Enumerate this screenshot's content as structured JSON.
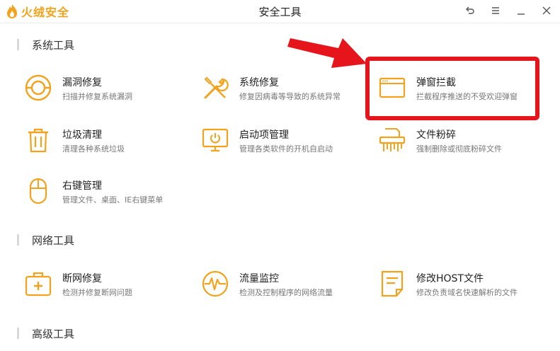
{
  "app": {
    "brand_name": "火绒安全",
    "window_title": "安全工具"
  },
  "sections": [
    {
      "title": "系统工具",
      "tools": [
        {
          "name": "漏洞修复",
          "desc": "扫描并修复系统漏洞",
          "icon": "vulnerability-repair-icon"
        },
        {
          "name": "系统修复",
          "desc": "修复因病毒等导致的系统异常",
          "icon": "system-repair-icon"
        },
        {
          "name": "弹窗拦截",
          "desc": "拦截程序推送的不受欢迎弹窗",
          "icon": "popup-block-icon"
        },
        {
          "name": "垃圾清理",
          "desc": "清理各种系统垃圾",
          "icon": "trash-clean-icon"
        },
        {
          "name": "启动项管理",
          "desc": "管理各类软件的开机自启动",
          "icon": "startup-manager-icon"
        },
        {
          "name": "文件粉碎",
          "desc": "强制删除或彻底粉碎文件",
          "icon": "file-shredder-icon"
        },
        {
          "name": "右键管理",
          "desc": "管理文件、桌面、IE右键菜单",
          "icon": "mouse-menu-icon"
        }
      ]
    },
    {
      "title": "网络工具",
      "tools": [
        {
          "name": "断网修复",
          "desc": "检测并修复断网问题",
          "icon": "network-repair-icon"
        },
        {
          "name": "流量监控",
          "desc": "检测及控制程序的网络流量",
          "icon": "traffic-monitor-icon"
        },
        {
          "name": "修改HOST文件",
          "desc": "修改负责域名快速解析的文件",
          "icon": "host-file-icon"
        }
      ]
    },
    {
      "title": "高级工具",
      "tools": []
    }
  ],
  "colors": {
    "accent": "#f2a21c",
    "highlight": "#e5151b"
  }
}
